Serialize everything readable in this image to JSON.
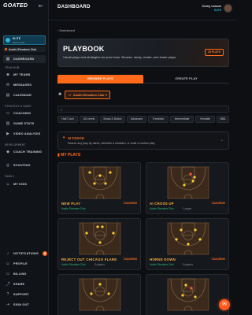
{
  "app": {
    "logo": "GOATED",
    "collapse_icon": "sidebar-collapse-icon"
  },
  "sidebar": {
    "plan": {
      "title": "ELITE",
      "subtitle": "Team Level"
    },
    "club": "Austin Elevators Club",
    "sections": {
      "team_hub": "TEAM HUB",
      "strategy": "STRATEGY & GAME",
      "development": "DEVELOPMENT",
      "family": "FAMILY"
    },
    "items": [
      {
        "label": "DASHBOARD",
        "icon": "grid-icon",
        "active": true
      },
      {
        "label": "MY TEAMS",
        "icon": "people-icon"
      },
      {
        "label": "MESSAGES",
        "icon": "chat-icon"
      },
      {
        "label": "CALENDAR",
        "icon": "calendar-icon"
      },
      {
        "label": "COACHING",
        "icon": "clipboard-icon"
      },
      {
        "label": "GAME STATS",
        "icon": "chart-icon"
      },
      {
        "label": "VIDEO ANALYSIS",
        "icon": "video-icon"
      },
      {
        "label": "COACH TRAINING",
        "icon": "graduation-icon"
      },
      {
        "label": "SCOUTING",
        "icon": "binoculars-icon"
      },
      {
        "label": "MY KIDS",
        "icon": "child-icon"
      }
    ],
    "bottom": [
      {
        "label": "NOTIFICATIONS",
        "badge": "8"
      },
      {
        "label": "PROFILE"
      },
      {
        "label": "BILLING"
      },
      {
        "label": "SHARE"
      },
      {
        "label": "SUPPORT"
      },
      {
        "label": "SIGN OUT"
      }
    ]
  },
  "topbar": {
    "title": "DASHBOARD",
    "user": {
      "name": "Corey Larson",
      "role": "ELITE"
    }
  },
  "main": {
    "back": "‹ Dashboard",
    "hero": {
      "title": "PLAYBOOK",
      "description": "Visual plays and strategies for your team. Browse, study, create, and share plays.",
      "button": "25 PLAYS"
    },
    "tabs": [
      "BROWSE PLAYS",
      "CREATE PLAY"
    ],
    "club_select": "Austin Elevators Club",
    "search_placeholder": "",
    "categories": [
      "Half Court",
      "All Levels",
      "Broad & Button",
      "Advanced",
      "Transition",
      "Intermediate",
      "Versatile",
      "NBA"
    ],
    "coach": {
      "title": "AI COACH",
      "subtitle": "Search any play by name, describe a situation, or build a custom play"
    },
    "my_plays_label": "MY PLAYS",
    "plays": [
      {
        "name": "NEW PLAY",
        "tag": "COACHING",
        "club": "Austin Elevators Club",
        "meta": ""
      },
      {
        "name": "AI CROSS UP",
        "tag": "COACHING",
        "club": "Austin Elevators Club",
        "meta": "1 player"
      },
      {
        "name": "REJECT OUT CHICAGO FLARE",
        "tag": "COACHING",
        "club": "Austin Elevators Club",
        "meta": "5 players"
      },
      {
        "name": "HORNS DOWN",
        "tag": "COACHING",
        "club": "Austin Elevators Club",
        "meta": "5 players"
      },
      {
        "name": "",
        "tag": "",
        "club": "",
        "meta": ""
      },
      {
        "name": "",
        "tag": "",
        "club": "",
        "meta": ""
      }
    ]
  },
  "fab_icon": "chat-bubble-icon"
}
